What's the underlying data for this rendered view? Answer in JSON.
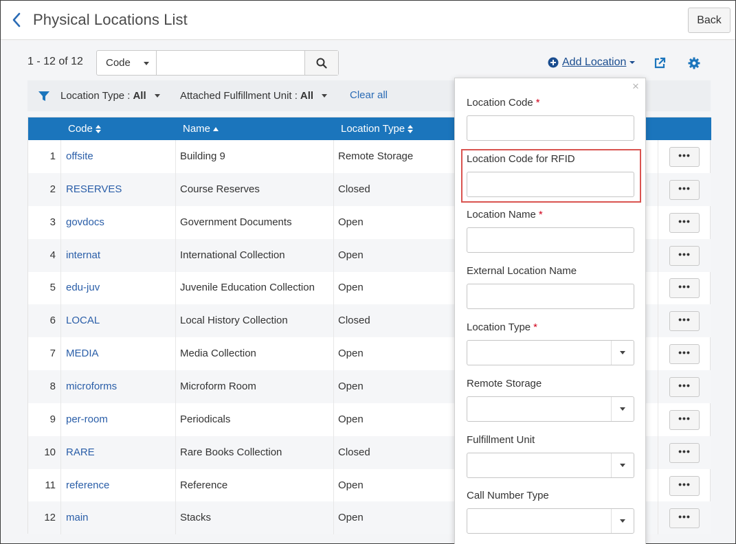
{
  "header": {
    "title": "Physical Locations List",
    "back_label": "Back"
  },
  "toolbar": {
    "count": "1 - 12 of 12",
    "search_field": "Code",
    "search_value": "",
    "add_location_label": "Add Location"
  },
  "filters": {
    "location_type_label": "Location Type :",
    "location_type_value": "All",
    "fulfillment_unit_label": "Attached Fulfillment Unit :",
    "fulfillment_unit_value": "All",
    "clear_all": "Clear all"
  },
  "table": {
    "columns": [
      "Code",
      "Name",
      "Location Type"
    ],
    "rows": [
      {
        "num": "1",
        "code": "offsite",
        "name": "Building 9",
        "type": "Remote Storage"
      },
      {
        "num": "2",
        "code": "RESERVES",
        "name": "Course Reserves",
        "type": "Closed"
      },
      {
        "num": "3",
        "code": "govdocs",
        "name": "Government Documents",
        "type": "Open"
      },
      {
        "num": "4",
        "code": "internat",
        "name": "International Collection",
        "type": "Open"
      },
      {
        "num": "5",
        "code": "edu-juv",
        "name": "Juvenile Education Collection",
        "type": "Open"
      },
      {
        "num": "6",
        "code": "LOCAL",
        "name": "Local History Collection",
        "type": "Closed"
      },
      {
        "num": "7",
        "code": "MEDIA",
        "name": "Media Collection",
        "type": "Open"
      },
      {
        "num": "8",
        "code": "microforms",
        "name": "Microform Room",
        "type": "Open"
      },
      {
        "num": "9",
        "code": "per-room",
        "name": "Periodicals",
        "type": "Open"
      },
      {
        "num": "10",
        "code": "RARE",
        "name": "Rare Books Collection",
        "type": "Closed"
      },
      {
        "num": "11",
        "code": "reference",
        "name": "Reference",
        "type": "Open"
      },
      {
        "num": "12",
        "code": "main",
        "name": "Stacks",
        "type": "Open"
      }
    ],
    "more_label": "•••"
  },
  "form": {
    "close": "×",
    "location_code": "Location Code",
    "location_code_rfid": "Location Code for RFID",
    "location_name": "Location Name",
    "external_location_name": "External Location Name",
    "location_type": "Location Type",
    "remote_storage": "Remote Storage",
    "fulfillment_unit": "Fulfillment Unit",
    "call_number_type": "Call Number Type",
    "required_mark": "*"
  },
  "colors": {
    "header_blue": "#1b75bc",
    "link": "#2a5ea8",
    "required": "#d0021b",
    "highlight": "#d9534f"
  }
}
